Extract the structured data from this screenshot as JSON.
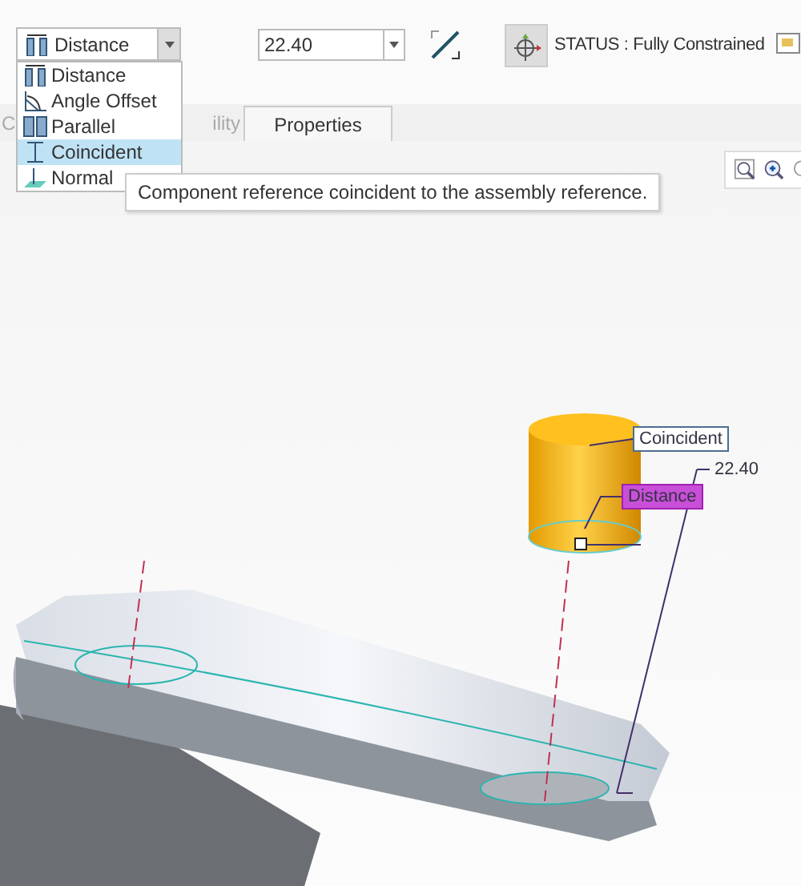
{
  "constraint_type": {
    "value": "Distance",
    "options": [
      {
        "label": "Distance",
        "kind": "distance",
        "highlighted": false
      },
      {
        "label": "Angle Offset",
        "kind": "angle",
        "highlighted": false
      },
      {
        "label": "Parallel",
        "kind": "parallel",
        "highlighted": false
      },
      {
        "label": "Coincident",
        "kind": "coincident",
        "highlighted": true
      },
      {
        "label": "Normal",
        "kind": "normal",
        "highlighted": false
      }
    ]
  },
  "offset": {
    "value": "22.40"
  },
  "status": "STATUS : Fully Constrained",
  "tabs": [
    {
      "label": "C",
      "selected": false
    },
    {
      "label": "ility",
      "selected": false
    },
    {
      "label": "Properties",
      "selected": true
    }
  ],
  "tooltip": "Component reference coincident to the assembly reference.",
  "annotations": [
    {
      "label": "Coincident",
      "kind": "coincident"
    },
    {
      "label": "Distance",
      "kind": "distance"
    },
    {
      "label": "22.40",
      "kind": "dimension"
    }
  ]
}
